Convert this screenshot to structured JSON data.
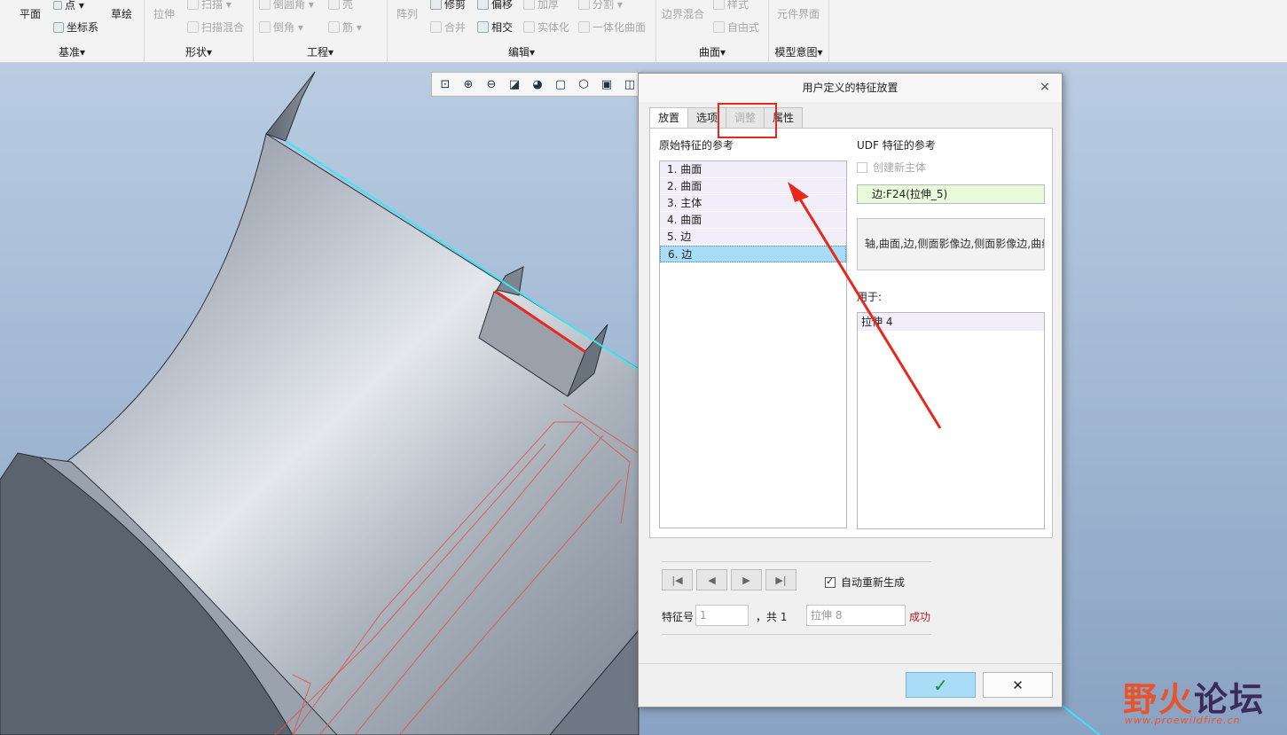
{
  "ribbon": {
    "groups": [
      {
        "label": "基准▾"
      },
      {
        "label": "形状▾"
      },
      {
        "label": "工程▾"
      },
      {
        "label": "编辑▾"
      },
      {
        "label": "曲面▾"
      },
      {
        "label": "模型意图▾"
      }
    ],
    "buttons": {
      "plane": "平面",
      "point": "点 ▾",
      "coord": "坐标系",
      "sketch": "草绘",
      "extrude": "拉伸",
      "sweep": "扫描 ▾",
      "swept_blend": "扫描混合",
      "round": "倒圆角 ▾",
      "chamfer": "倒角 ▾",
      "shell": "壳",
      "rib": "筋 ▾",
      "pattern": "阵列",
      "trim": "修剪",
      "offset": "偏移",
      "thicken": "加厚",
      "split": "分割 ▾",
      "merge": "合并",
      "intersect": "相交",
      "solidify": "实体化",
      "unify_surface": "一体化曲面",
      "boundary_blend": "边界混合",
      "style": "样式",
      "freestyle": "自由式",
      "component_interface": "元件界面"
    }
  },
  "dialog": {
    "title": "用户定义的特征放置",
    "close": "×",
    "tabs": [
      "放置",
      "选项",
      "调整",
      "属性"
    ],
    "original_refs_label": "原始特征的参考",
    "original_refs": [
      "1. 曲面",
      "2. 曲面",
      "3. 主体",
      "4. 曲面",
      "5. 边",
      "6. 边"
    ],
    "udf_refs_label": "UDF 特征的参考",
    "create_new_body": "创建新主体",
    "selected_ref": "边:F24(拉伸_5)",
    "ref_types": "轴,曲面,边,侧面影像边,侧面影像边,曲线",
    "used_in_label": "用于:",
    "used_in": [
      "拉伸 4"
    ],
    "auto_regen": "自动重新生成",
    "feature_num_label": "特征号",
    "feature_num": "1",
    "total": "，共 1",
    "feature_name": "拉伸 8",
    "status": "成功",
    "ok": "✓",
    "cancel": "✕"
  },
  "watermark": {
    "text_a": "野火",
    "text_b": "论坛",
    "url": "www.proewildfire.cn"
  },
  "colors": {
    "accent_selected": "#a9dcf6",
    "annotation_red": "#e8281c",
    "status_red": "#b2201a"
  }
}
